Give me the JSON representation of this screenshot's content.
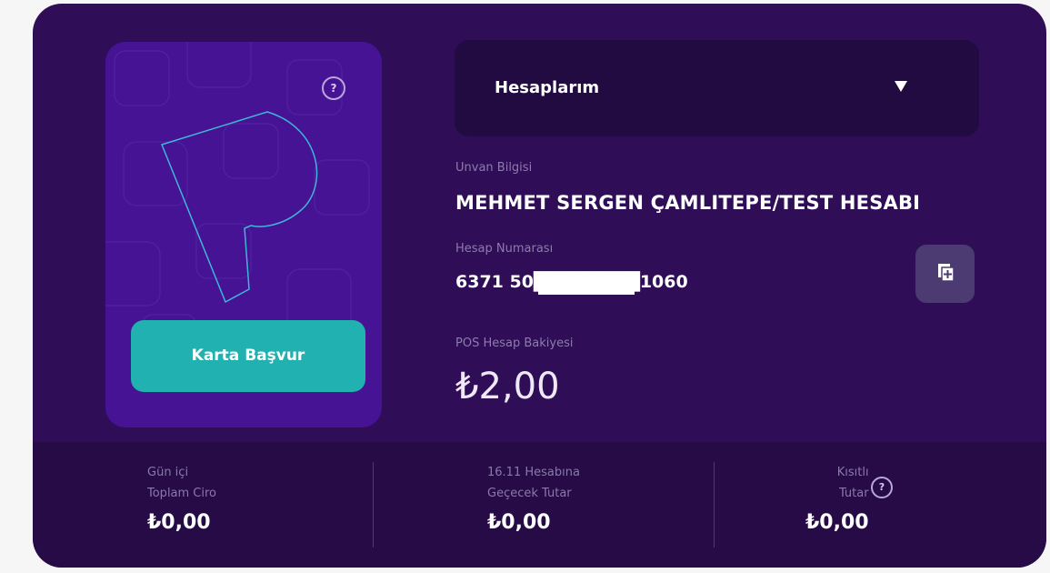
{
  "card": {
    "apply_button_label": "Karta Başvur",
    "help_label": "?"
  },
  "accounts_dropdown": {
    "label": "Hesaplarım"
  },
  "account": {
    "title_label": "Unvan Bilgisi",
    "title_value": "MEHMET SERGEN ÇAMLITEPE/TEST HESABI",
    "number_label": "Hesap Numarası",
    "number_value": "6371 50████████1060",
    "balance_label": "POS Hesap Bakiyesi",
    "balance_value": "₺2,00"
  },
  "stats": [
    {
      "label_line1": "Gün içi",
      "label_line2": "Toplam Ciro",
      "value": "₺0,00"
    },
    {
      "label_line1": "16.11 Hesabına",
      "label_line2": "Geçecek Tutar",
      "value": "₺0,00"
    },
    {
      "label_line1": "Kısıtlı",
      "label_line2": "Tutar",
      "value": "₺0,00"
    }
  ],
  "stats_help_label": "?",
  "colors": {
    "background": "#2f0d57",
    "card": "#451394",
    "accent_button": "#22b1b1",
    "dropdown": "#220b40"
  }
}
